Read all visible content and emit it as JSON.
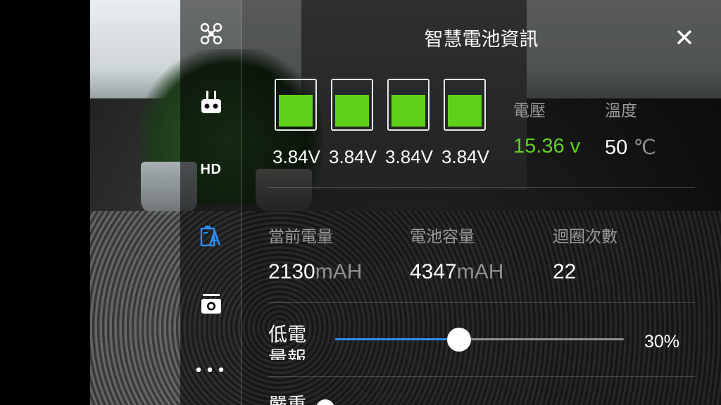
{
  "sidebar": {
    "items": [
      {
        "icon": "drone-icon"
      },
      {
        "icon": "remote-controller-icon"
      },
      {
        "label": "HD"
      },
      {
        "icon": "battery-icon",
        "active": true
      },
      {
        "icon": "camera-icon"
      },
      {
        "icon": "more-icon"
      }
    ]
  },
  "panel": {
    "title": "智慧電池資訊",
    "close_icon": "close-icon"
  },
  "cells": [
    {
      "voltage": "3.84V",
      "level": 0.7
    },
    {
      "voltage": "3.84V",
      "level": 0.7
    },
    {
      "voltage": "3.84V",
      "level": 0.7
    },
    {
      "voltage": "3.84V",
      "level": 0.7
    }
  ],
  "voltage": {
    "label": "電壓",
    "value": "15.36 v"
  },
  "temperature": {
    "label": "溫度",
    "value": "50",
    "unit": "℃"
  },
  "current_charge": {
    "label": "當前電量",
    "value": "2130",
    "unit": "mAH"
  },
  "capacity": {
    "label": "電池容量",
    "value": "4347",
    "unit": "mAH"
  },
  "cycles": {
    "label": "迴圈次數",
    "value": "22"
  },
  "low_battery": {
    "label": "低電量報警",
    "value": 30,
    "display": "30%"
  },
  "next_row": {
    "label": "嚴重"
  },
  "colors": {
    "accent": "#2f8cf0",
    "good": "#5fd11a"
  }
}
